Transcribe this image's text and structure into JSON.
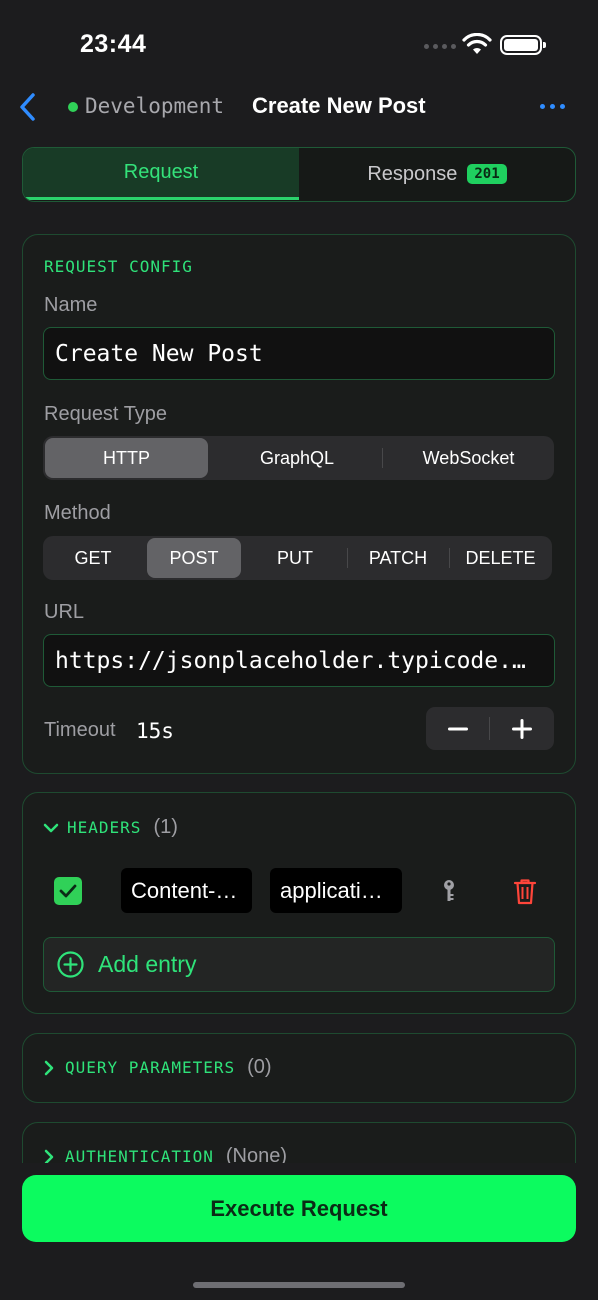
{
  "status_bar": {
    "time": "23:44"
  },
  "nav": {
    "environment": "Development",
    "title": "Create New Post"
  },
  "tabs": {
    "request": "Request",
    "response": "Response",
    "response_status": "201"
  },
  "request_config": {
    "section_title": "REQUEST CONFIG",
    "name_label": "Name",
    "name_value": "Create New Post",
    "type_label": "Request Type",
    "types": [
      "HTTP",
      "GraphQL",
      "WebSocket"
    ],
    "selected_type": "HTTP",
    "method_label": "Method",
    "methods": [
      "GET",
      "POST",
      "PUT",
      "PATCH",
      "DELETE"
    ],
    "selected_method": "POST",
    "url_label": "URL",
    "url_value": "https://jsonplaceholder.typicode.…",
    "timeout_label": "Timeout",
    "timeout_value": "15s"
  },
  "headers": {
    "title": "HEADERS",
    "count": "(1)",
    "entries": [
      {
        "enabled": true,
        "key": "Content-…",
        "value": "applicati…"
      }
    ],
    "add_label": "Add entry"
  },
  "query_parameters": {
    "title": "QUERY PARAMETERS",
    "count": "(0)"
  },
  "authentication": {
    "title": "AUTHENTICATION",
    "count": "(None)"
  },
  "actions": {
    "execute": "Execute Request"
  },
  "colors": {
    "accent_green": "#2fe37a",
    "execute_green": "#0cfb5f",
    "link_blue": "#2f8cff",
    "delete_red": "#ff453a"
  }
}
